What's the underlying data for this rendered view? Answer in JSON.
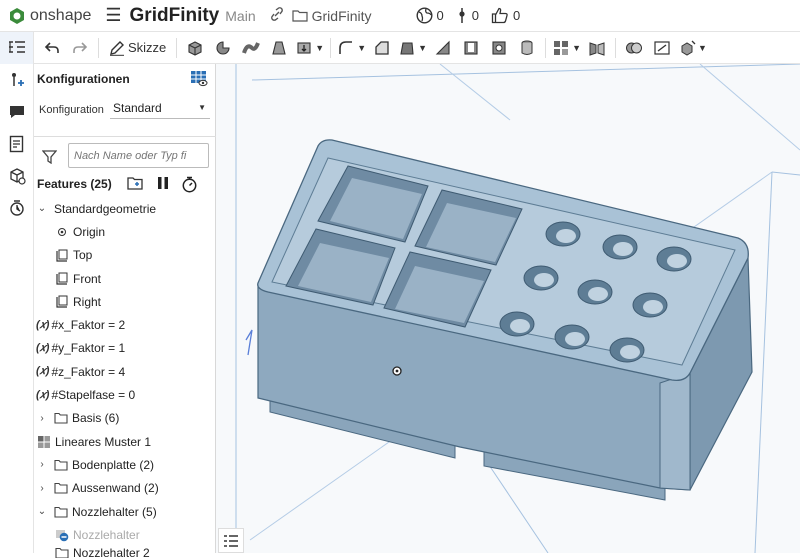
{
  "app": {
    "brand": "onshape",
    "document_title": "GridFinity",
    "branch": "Main",
    "folder": "GridFinity",
    "counts": {
      "workspaces": "0",
      "versions": "0",
      "likes": "0"
    }
  },
  "toolbar": {
    "sketch_label": "Skizze",
    "icons": [
      "undo-icon",
      "redo-icon",
      "sketch-icon",
      "extrude-icon",
      "revolve-icon",
      "sweep-icon",
      "loft-icon",
      "thicken-icon",
      "fillet-icon",
      "chamfer-icon",
      "draft-icon",
      "rib-icon",
      "shell-icon",
      "hole-icon",
      "pattern-icon",
      "mirror-icon",
      "boolean-icon",
      "split-icon",
      "transform-icon"
    ]
  },
  "panel": {
    "config_title": "Konfigurationen",
    "config_label": "Konfiguration",
    "config_value": "Standard",
    "filter_placeholder": "Nach Name oder Typ fi",
    "features_title": "Features (25)",
    "tree": [
      {
        "label": "Standardgeometrie",
        "expanded": true,
        "icon": "chevron-down"
      },
      {
        "label": "Origin",
        "icon": "origin-icon"
      },
      {
        "label": "Top",
        "icon": "plane-icon"
      },
      {
        "label": "Front",
        "icon": "plane-icon"
      },
      {
        "label": "Right",
        "icon": "plane-icon"
      },
      {
        "label": "#x_Faktor = 2",
        "icon": "variable-icon"
      },
      {
        "label": "#y_Faktor = 1",
        "icon": "variable-icon"
      },
      {
        "label": "#z_Faktor = 4",
        "icon": "variable-icon"
      },
      {
        "label": "#Stapelfase = 0",
        "icon": "variable-icon"
      },
      {
        "label": "Basis (6)",
        "icon": "folder-icon"
      },
      {
        "label": "Lineares Muster 1",
        "icon": "pattern-icon"
      },
      {
        "label": "Bodenplatte (2)",
        "icon": "folder-icon"
      },
      {
        "label": "Aussenwand (2)",
        "icon": "folder-icon"
      },
      {
        "label": "Nozzlehalter (5)",
        "icon": "folder-icon"
      },
      {
        "label": "Nozzlehalter",
        "icon": "suppressed-icon"
      },
      {
        "label": "Nozzlehalter 2",
        "icon": "folder-icon"
      }
    ]
  },
  "colors": {
    "part_fill": "#a9c2d6",
    "part_dark": "#7d99b0",
    "part_edge": "#4a6880",
    "plane_edge": "#8fb2d8",
    "accent": "#2a6fb5"
  }
}
